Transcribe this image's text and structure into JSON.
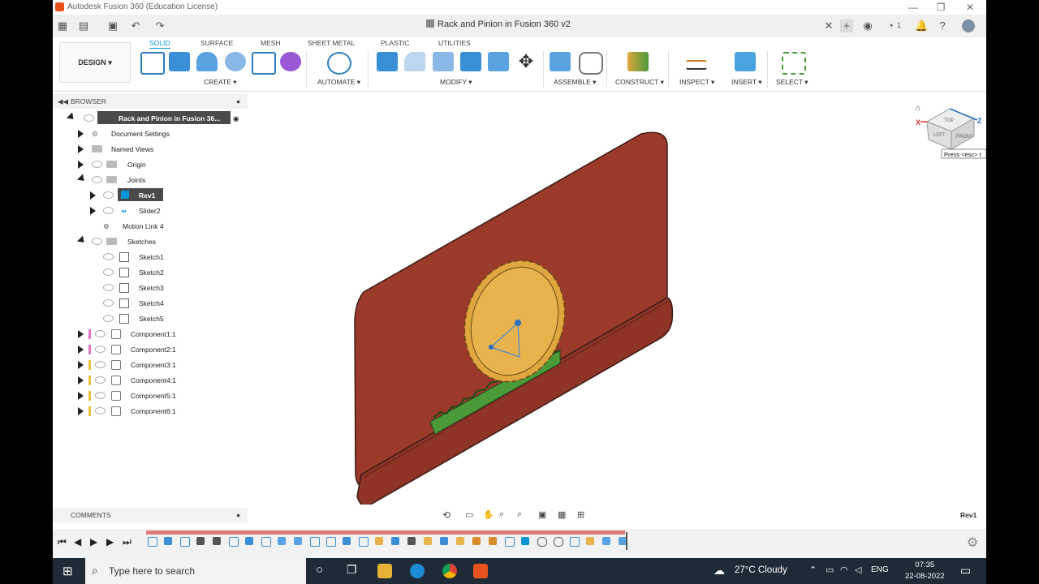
{
  "window": {
    "title": "Autodesk Fusion 360 (Education License)",
    "document_tab": "Rack and Pinion in Fusion 360 v2",
    "notifications": "1"
  },
  "tabs": [
    "SOLID",
    "SURFACE",
    "MESH",
    "SHEET METAL",
    "PLASTIC",
    "UTILITIES"
  ],
  "workspace": "DESIGN ▾",
  "groups": [
    "CREATE ▾",
    "AUTOMATE ▾",
    "MODIFY ▾",
    "ASSEMBLE ▾",
    "CONSTRUCT ▾",
    "INSPECT ▾",
    "INSERT ▾",
    "SELECT ▾"
  ],
  "browser": {
    "title": "BROWSER",
    "root": "Rack and Pinion in Fusion 36...",
    "items": [
      {
        "label": "Document Settings"
      },
      {
        "label": "Named Views"
      },
      {
        "label": "Origin"
      },
      {
        "label": "Joints"
      },
      {
        "label": "Rev1"
      },
      {
        "label": "Slider2"
      },
      {
        "label": "Motion Link 4"
      },
      {
        "label": "Sketches"
      },
      {
        "label": "Sketch1"
      },
      {
        "label": "Sketch2"
      },
      {
        "label": "Sketch3"
      },
      {
        "label": "Sketch4"
      },
      {
        "label": "Sketch5"
      },
      {
        "label": "Component1:1"
      },
      {
        "label": "Component2:1"
      },
      {
        "label": "Component3:1"
      },
      {
        "label": "Component4:1"
      },
      {
        "label": "Component5:1"
      },
      {
        "label": "Component6:1"
      }
    ]
  },
  "viewcube": {
    "top": "TOP",
    "left": "LEFT",
    "front": "FRONT",
    "x": "X",
    "z": "Z",
    "tooltip": "Press <esc> t"
  },
  "comments": "COMMENTS",
  "status_selection": "Rev1",
  "taskbar": {
    "search_placeholder": "Type here to search",
    "weather": "27°C  Cloudy",
    "lang": "ENG",
    "time": "07:35",
    "date": "22-08-2022"
  },
  "colors": {
    "accent": "#0696d7",
    "plate": "#9b3a2a",
    "gear": "#e0a63f",
    "rack": "#4b9a3a"
  }
}
